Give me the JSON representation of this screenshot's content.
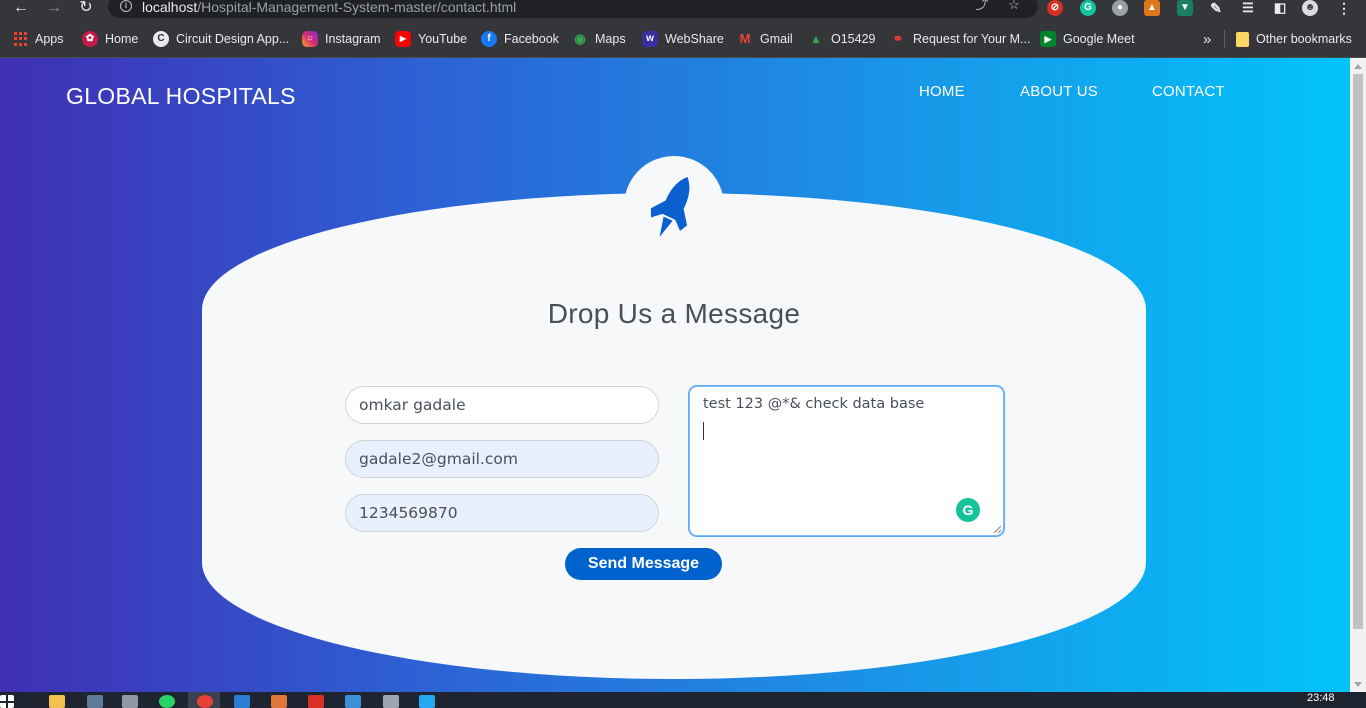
{
  "browser": {
    "url_host": "localhost",
    "url_path": "/Hospital-Management-System-master/contact.html"
  },
  "bookmarks": [
    {
      "label": "Apps",
      "icon": "apps-grid-icon"
    },
    {
      "label": "Home",
      "icon": "raspberry-icon"
    },
    {
      "label": "Circuit Design App...",
      "icon": "circuit-icon"
    },
    {
      "label": "Instagram",
      "icon": "instagram-icon"
    },
    {
      "label": "YouTube",
      "icon": "youtube-icon"
    },
    {
      "label": "Facebook",
      "icon": "facebook-icon"
    },
    {
      "label": "Maps",
      "icon": "maps-icon"
    },
    {
      "label": "WebShare",
      "icon": "webshare-icon"
    },
    {
      "label": "Gmail",
      "icon": "gmail-icon"
    },
    {
      "label": "O15429",
      "icon": "o15429-icon"
    },
    {
      "label": "Request for Your M...",
      "icon": "request-icon"
    },
    {
      "label": "Google Meet",
      "icon": "google-meet-icon"
    }
  ],
  "bookmarks_overflow": "»",
  "other_bookmarks": "Other bookmarks",
  "site": {
    "brand": "GLOBAL HOSPITALS",
    "nav": [
      "HOME",
      "ABOUT US",
      "CONTACT"
    ]
  },
  "contact_form": {
    "heading": "Drop Us a Message",
    "name_value": "omkar gadale",
    "email_value": "gadale2@gmail.com",
    "phone_value": "1234569870",
    "message_value": "test 123 @*& check data base",
    "submit_label": "Send Message"
  },
  "taskbar": {
    "clock": "23:48"
  },
  "colors": {
    "gradient_start": "#3f2fb4",
    "gradient_end": "#02c3fa",
    "button": "#0062cc",
    "card": "#f6f8fa",
    "rocket": "#0b5fcf"
  }
}
